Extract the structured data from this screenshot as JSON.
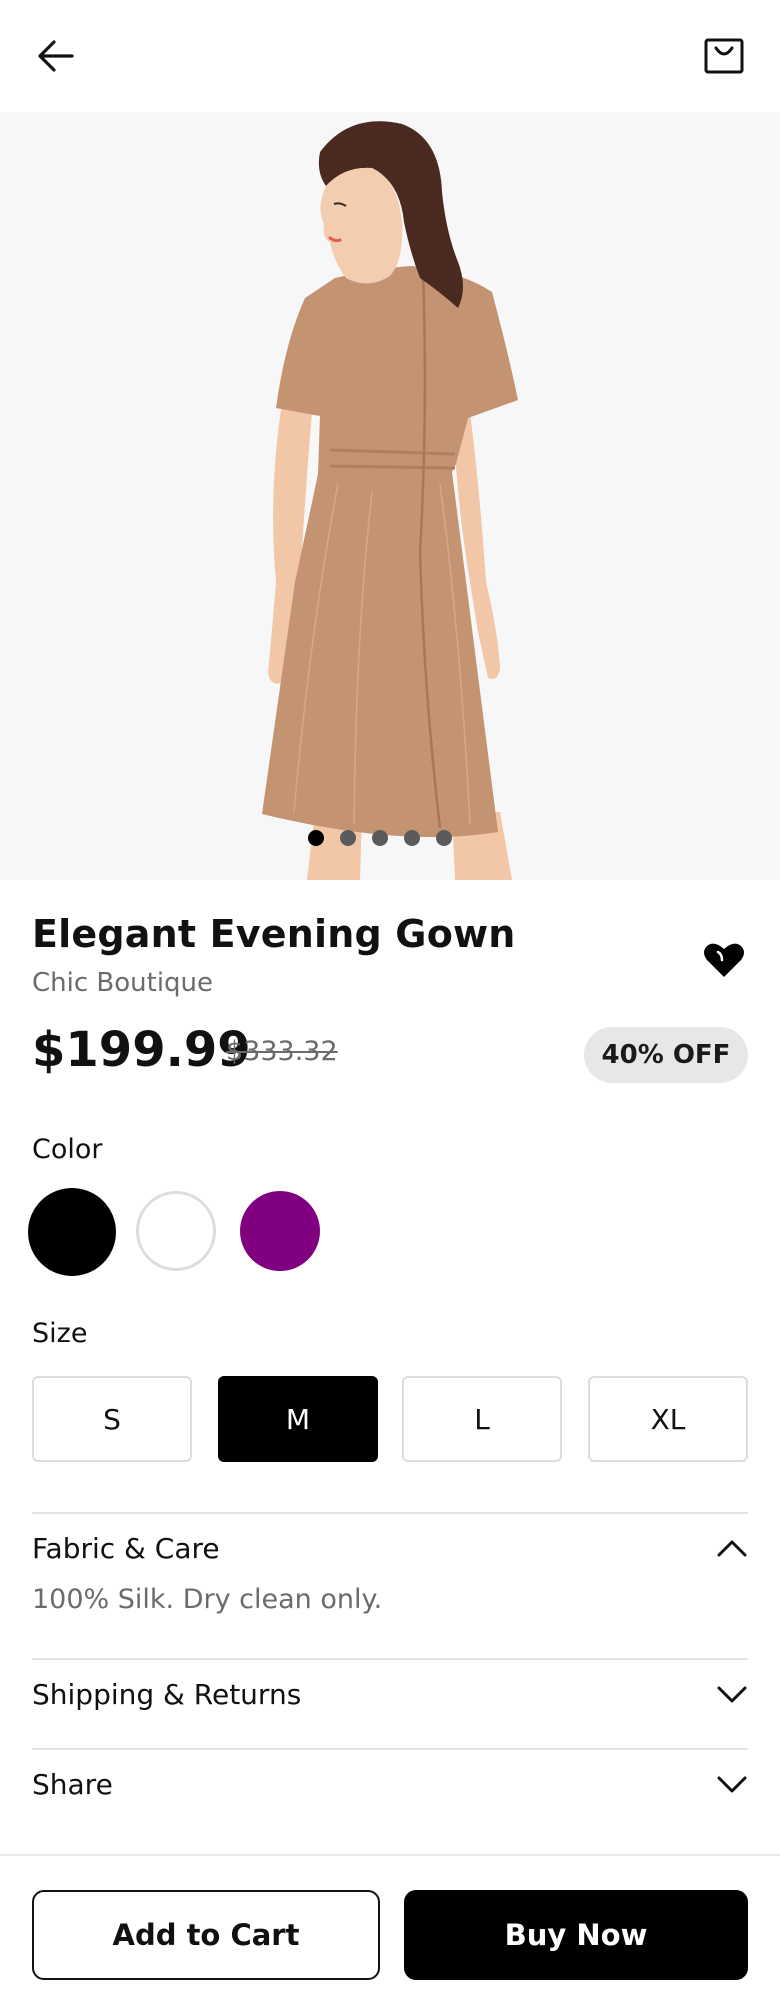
{
  "header": {
    "back_icon": "arrow-left-icon",
    "bag_icon": "shopping-bag-icon"
  },
  "gallery": {
    "image_alt": "Woman wearing a tan short-sleeve dress, back view",
    "dot_count": 5,
    "active_dot": 1
  },
  "product": {
    "title": "Elegant Evening Gown",
    "brand": "Chic Boutique",
    "price": "$199.99",
    "original_price": "$333.32",
    "discount_badge": "40% OFF",
    "wishlist_icon": "heart-icon"
  },
  "color": {
    "label": "Color",
    "options": [
      {
        "name": "black",
        "hex": "#000000",
        "selected": true
      },
      {
        "name": "white",
        "hex": "#FFFFFF",
        "selected": false
      },
      {
        "name": "purple",
        "hex": "#800080",
        "selected": false
      }
    ]
  },
  "size": {
    "label": "Size",
    "options": [
      "S",
      "M",
      "L",
      "XL"
    ],
    "selected": "M"
  },
  "accordion": {
    "fabric": {
      "title": "Fabric & Care",
      "content": "100% Silk. Dry clean only.",
      "expanded": true,
      "icon": "chevron-up-icon"
    },
    "shipping": {
      "title": "Shipping & Returns",
      "expanded": false,
      "icon": "chevron-down-icon"
    },
    "share": {
      "title": "Share",
      "expanded": false,
      "icon": "chevron-down-icon"
    }
  },
  "actions": {
    "add_to_cart": "Add to Cart",
    "buy_now": "Buy Now"
  },
  "colors": {
    "primary": "#000000",
    "muted_text": "#6B6B6B",
    "badge_bg": "#E7E7E7",
    "border": "#DDDDDD",
    "dress": "#C49371"
  }
}
